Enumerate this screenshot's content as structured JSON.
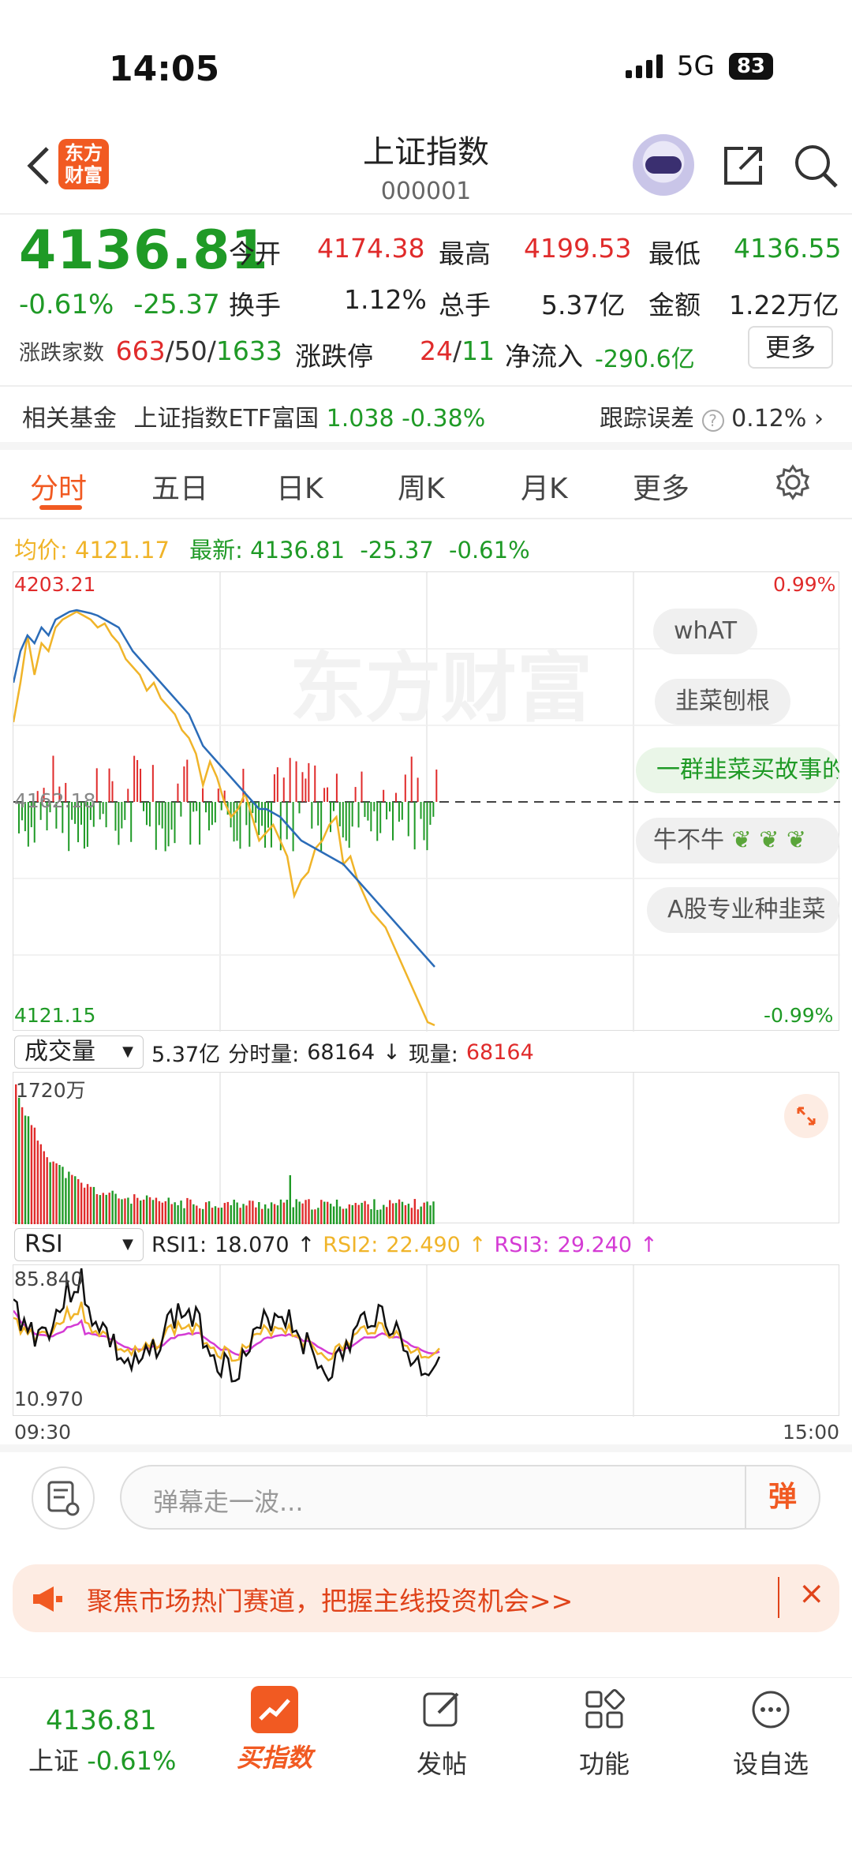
{
  "status_bar": {
    "time": "14:05",
    "network": "5G",
    "battery": "83"
  },
  "header": {
    "title": "上证指数",
    "code": "000001",
    "logo_text": "东方\n财富"
  },
  "quote": {
    "price": "4136.81",
    "change_pct": "-0.61%",
    "change_val": "-25.37",
    "open_label": "今开",
    "open": "4174.38",
    "high_label": "最高",
    "high": "4199.53",
    "low_label": "最低",
    "low": "4136.55",
    "turnover_label": "换手",
    "turnover": "1.12%",
    "vol_label": "总手",
    "vol": "5.37亿",
    "amount_label": "金额",
    "amount": "1.22万亿",
    "updown_label": "涨跌家数",
    "up": "663",
    "flat": "50",
    "down": "1633",
    "limit_label": "涨跌停",
    "limit_up": "24",
    "limit_down": "11",
    "netflow_label": "净流入",
    "netflow": "-290.6亿",
    "more_label": "更多"
  },
  "fund": {
    "label": "相关基金",
    "name": "上证指数ETF富国",
    "price": "1.038",
    "change": "-0.38%",
    "track_label": "跟踪误差",
    "track_value": "0.12%"
  },
  "tabs": [
    {
      "label": "分时"
    },
    {
      "label": "五日"
    },
    {
      "label": "日K"
    },
    {
      "label": "周K"
    },
    {
      "label": "月K"
    },
    {
      "label": "更多"
    }
  ],
  "intraday": {
    "avg_label": "均价:",
    "avg": "4121.17",
    "latest_label": "最新:",
    "latest": "4136.81",
    "latest_chg": "-25.37",
    "latest_pct": "-0.61%",
    "y_top": "4203.21",
    "y_mid": "4162.18",
    "y_bot": "4121.15",
    "pct_top": "0.99%",
    "pct_bot": "-0.99%",
    "watermark": "东方财富"
  },
  "danmaku": [
    "whAT",
    "韭菜刨根",
    "一群韭菜买故事的",
    "牛不牛",
    "A股专业种韭菜"
  ],
  "volume": {
    "select": "成交量",
    "total": "5.37亿",
    "period_label": "分时量:",
    "period": "68164",
    "arrow": "↓",
    "now_label": "现量:",
    "now": "68164",
    "max_label": "1720万"
  },
  "rsi": {
    "select": "RSI",
    "rsi1_label": "RSI1:",
    "rsi1": "18.070",
    "rsi2_label": "RSI2:",
    "rsi2": "22.490",
    "rsi3_label": "RSI3:",
    "rsi3": "29.240",
    "up_arrow": "↑",
    "y_top": "85.840",
    "y_bot": "10.970",
    "t_start": "09:30",
    "t_end": "15:00"
  },
  "comment_input": {
    "placeholder": "弹幕走一波...",
    "danmaku_btn": "弹"
  },
  "banner": {
    "text": "聚焦市场热门赛道，把握主线投资机会>>"
  },
  "bottom_nav": {
    "index_price": "4136.81",
    "index_name": "上证",
    "index_pct": "-0.61%",
    "items": [
      {
        "label": "买指数"
      },
      {
        "label": "发帖"
      },
      {
        "label": "功能"
      },
      {
        "label": "设自选"
      }
    ]
  },
  "colors": {
    "accent": "#f15a22",
    "up": "#e02b2b",
    "down": "#1f9a26",
    "avg_line": "#f0b429",
    "price_line": "#2b6cb8",
    "rsi3": "#d43bd4"
  }
}
